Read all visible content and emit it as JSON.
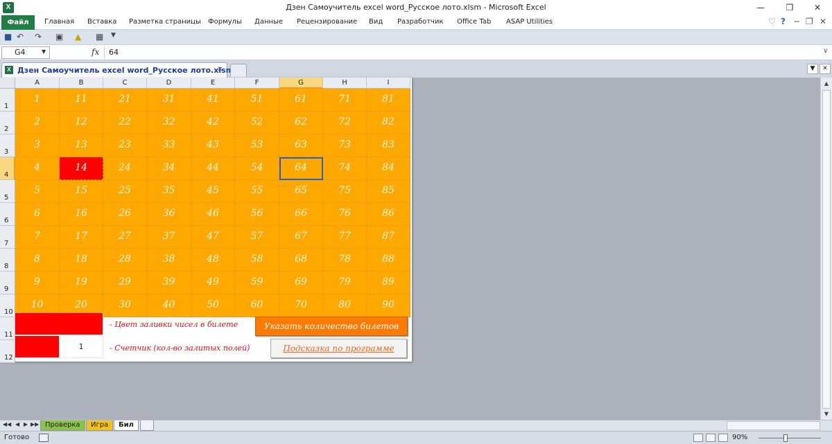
{
  "window": {
    "title": "Дзен Самоучитель excel word_Русское лото.xlsm  -  Microsoft Excel",
    "app_icon": "X"
  },
  "ribbon": {
    "file_tab": "Файл",
    "tabs": [
      "Главная",
      "Вставка",
      "Разметка страницы",
      "Формулы",
      "Данные",
      "Рецензирование",
      "Вид",
      "Разработчик",
      "Office Tab",
      "ASAP Utilities"
    ]
  },
  "formula_bar": {
    "name_box": "G4",
    "fx": "fx",
    "value": "64"
  },
  "document_tab": {
    "label": "Дзен Самоучитель excel word_Русское лото.xlsm *",
    "icon_letter": "X"
  },
  "grid": {
    "columns": [
      "A",
      "B",
      "C",
      "D",
      "E",
      "F",
      "G",
      "H",
      "I"
    ],
    "rows": [
      "1",
      "2",
      "3",
      "4",
      "5",
      "6",
      "7",
      "8",
      "9",
      "10",
      "11",
      "12"
    ],
    "selected_column": "G",
    "selected_row": "4",
    "numbers": [
      [
        "1",
        "11",
        "21",
        "31",
        "41",
        "51",
        "61",
        "71",
        "81"
      ],
      [
        "2",
        "12",
        "22",
        "32",
        "42",
        "52",
        "62",
        "72",
        "82"
      ],
      [
        "3",
        "13",
        "23",
        "33",
        "43",
        "53",
        "63",
        "73",
        "83"
      ],
      [
        "4",
        "14",
        "24",
        "34",
        "44",
        "54",
        "64",
        "74",
        "84"
      ],
      [
        "5",
        "15",
        "25",
        "35",
        "45",
        "55",
        "65",
        "75",
        "85"
      ],
      [
        "6",
        "16",
        "26",
        "36",
        "46",
        "56",
        "66",
        "76",
        "86"
      ],
      [
        "7",
        "17",
        "27",
        "37",
        "47",
        "57",
        "67",
        "77",
        "87"
      ],
      [
        "8",
        "18",
        "28",
        "38",
        "48",
        "58",
        "68",
        "78",
        "88"
      ],
      [
        "9",
        "19",
        "29",
        "39",
        "49",
        "59",
        "69",
        "79",
        "89"
      ],
      [
        "10",
        "20",
        "30",
        "40",
        "50",
        "60",
        "70",
        "80",
        "90"
      ]
    ],
    "marked_cells": [
      "B4"
    ],
    "active_cell": "G4",
    "colors": {
      "fill": "#ffa800",
      "marked": "#ff0000",
      "active_border": "#2c5fbf"
    }
  },
  "legend": {
    "fill_color_text": "- Цвет заливки чисел в билете",
    "counter_text": "- Счетчик (кол-во залитых полей)",
    "counter_value": "1"
  },
  "buttons": {
    "tickets": "Указать количество билетов",
    "hint": "Подсказка по программе"
  },
  "sheets": {
    "tabs": [
      "Проверка",
      "Игра",
      "Бил"
    ],
    "active": "Бил"
  },
  "status": {
    "ready": "Готово",
    "zoom": "90%"
  }
}
